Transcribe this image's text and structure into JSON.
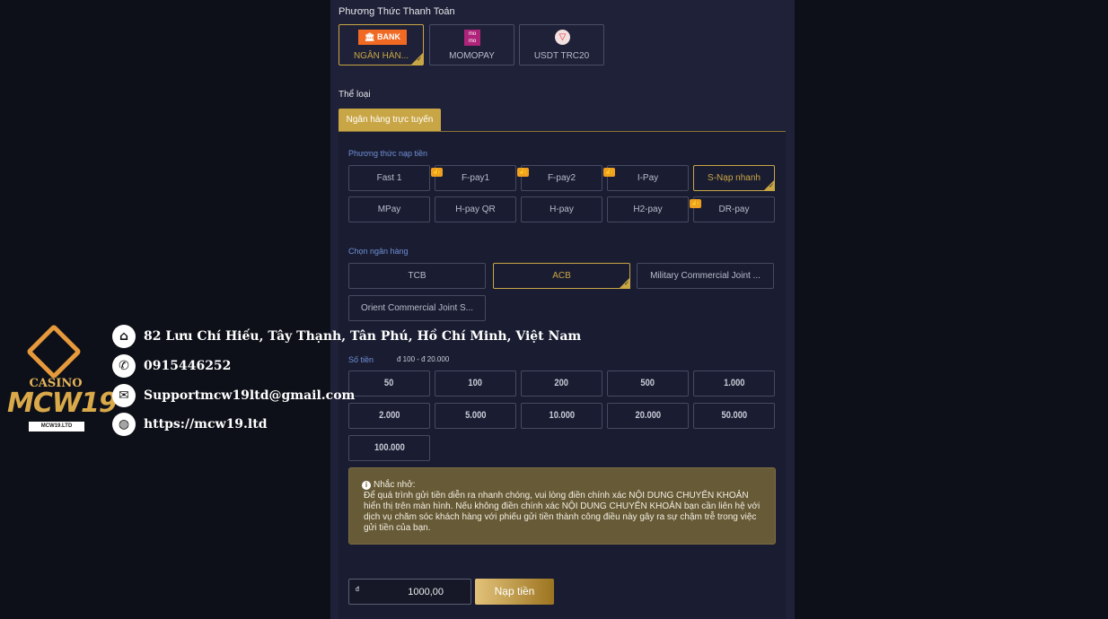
{
  "payment": {
    "title": "Phương Thức Thanh Toán",
    "methods": [
      {
        "label": "NGÂN HÀN...",
        "logo": "BANK",
        "selected": true
      },
      {
        "label": "MOMOPAY",
        "logo": "momo"
      },
      {
        "label": "USDT TRC20",
        "logo": "tron"
      }
    ]
  },
  "category": {
    "title": "Thể loại",
    "tab": "Ngân hàng trực tuyến"
  },
  "deposit_methods": {
    "title": "Phương thức nạp tiền",
    "items": [
      {
        "label": "Fast 1"
      },
      {
        "label": "F-pay1",
        "hot": true
      },
      {
        "label": "F-pay2",
        "hot": true
      },
      {
        "label": "I-Pay",
        "hot": true
      },
      {
        "label": "S-Nạp nhanh",
        "selected": true
      },
      {
        "label": "MPay"
      },
      {
        "label": "H-pay QR"
      },
      {
        "label": "H-pay"
      },
      {
        "label": "H2-pay"
      },
      {
        "label": "DR-pay",
        "hot": true
      }
    ]
  },
  "banks": {
    "title": "Chọn ngân hàng",
    "items": [
      "TCB",
      "ACB",
      "Military Commercial Joint ...",
      "Orient Commercial Joint S..."
    ],
    "selected": "ACB"
  },
  "amount": {
    "title": "Số tiền",
    "range": "đ 100 - đ 20.000",
    "options": [
      "50",
      "100",
      "200",
      "500",
      "1.000",
      "2.000",
      "5.000",
      "10.000",
      "20.000",
      "50.000",
      "100.000"
    ]
  },
  "notice": {
    "title": "Nhắc nhở:",
    "text": "Để quá trình gửi tiền diễn ra nhanh chóng, vui lòng điền chính xác NỘI DUNG CHUYỂN KHOẢN hiển thị trên màn hình. Nếu không điền chính xác NỘI DUNG CHUYỂN KHOẢN bạn cần liên hệ với dịch vụ chăm sóc khách hàng với phiếu gửi tiền thành công điều này gây ra sự chậm trễ trong việc gửi tiền của bạn."
  },
  "form": {
    "currency": "đ",
    "value": "1000,00",
    "submit": "Nạp tiền"
  },
  "overlay": {
    "logo_casino": "CASINO",
    "logo_brand": "MCW19",
    "logo_domain": "MCW19.LTD",
    "address": "82 Lưu Chí Hiếu, Tây Thạnh, Tân Phú, Hồ Chí Minh, Việt Nam",
    "phone": "0915446252",
    "email": "Supportmcw19ltd@gmail.com",
    "website": "https://mcw19.ltd"
  },
  "colors": {
    "accent": "#c9a645",
    "panel": "#1e2137",
    "background": "#0e1019",
    "notice": "#675a37"
  }
}
